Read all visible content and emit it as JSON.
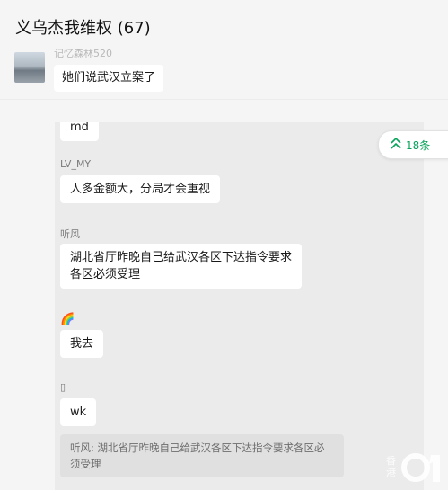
{
  "window": {
    "title": "义乌杰我维权 (67)"
  },
  "top_message": {
    "sender": "记忆森林520",
    "text": "她们说武汉立案了"
  },
  "new_messages_button": {
    "label": "18条"
  },
  "messages": [
    {
      "sender": "",
      "text": "md"
    },
    {
      "sender": "LV_MY",
      "text": "人多金额大，分局才会重视"
    },
    {
      "sender": "听风",
      "lines": [
        "湖北省厅昨晚自己给武汉各区下达指令要求",
        "各区必须受理"
      ]
    },
    {
      "sender": "🌈",
      "text": "我去"
    },
    {
      "sender": "▯",
      "text": "wk"
    }
  ],
  "quote": {
    "text": "听风: 湖北省厅昨晚自己给武汉各区下达指令要求各区必须受理"
  },
  "watermark": {
    "text": "香港01"
  },
  "colors": {
    "accent_green": "#07a35a",
    "panel_bg": "#ebebeb",
    "page_bg": "#f5f5f5"
  }
}
